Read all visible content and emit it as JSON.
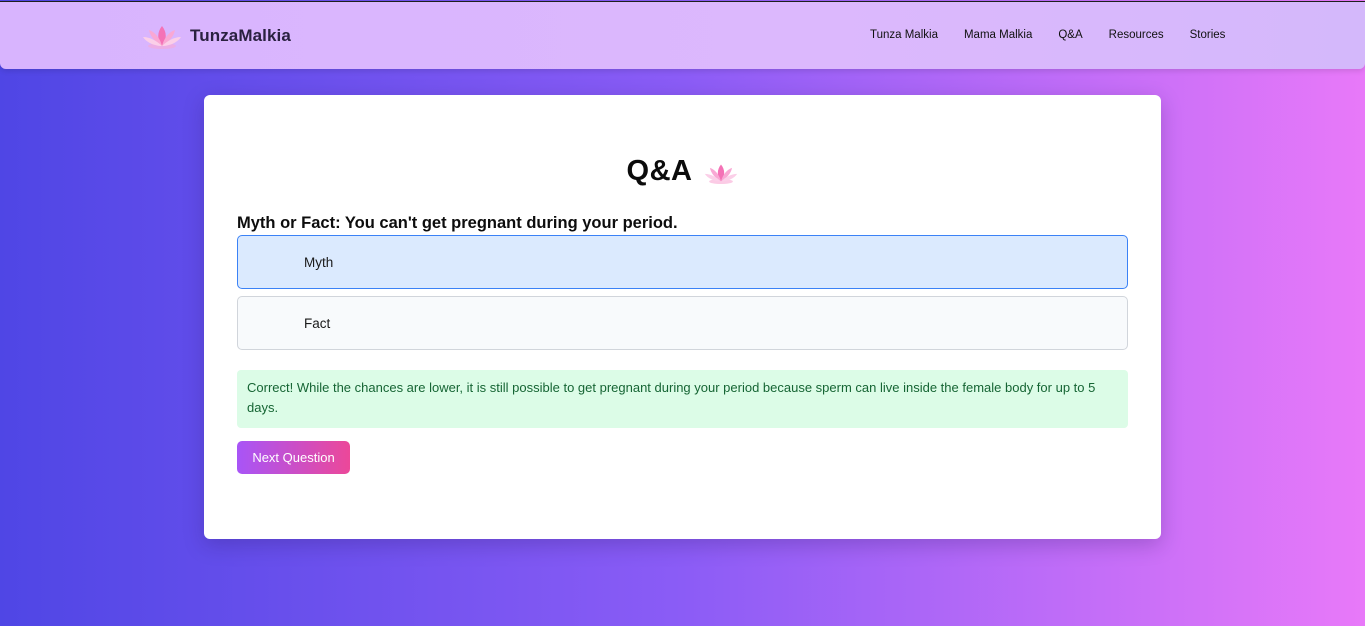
{
  "header": {
    "brand_name": "TunzaMalkia",
    "logo_icon": "lotus-icon",
    "nav": [
      {
        "label": "Tunza Malkia"
      },
      {
        "label": "Mama Malkia"
      },
      {
        "label": "Q&A"
      },
      {
        "label": "Resources"
      },
      {
        "label": "Stories"
      }
    ]
  },
  "main": {
    "title": "Q&A",
    "title_icon": "lotus-icon",
    "question": "Myth or Fact: You can't get pregnant during your period.",
    "options": [
      {
        "label": "Myth",
        "selected": true
      },
      {
        "label": "Fact",
        "selected": false
      }
    ],
    "feedback": "Correct! While the chances are lower, it is still possible to get pregnant during your period because sperm can live inside the female body for up to 5 days.",
    "next_label": "Next Question"
  },
  "colors": {
    "selected_bg": "#dbeafe",
    "selected_border": "#3b82f6",
    "feedback_bg": "#dcfce7",
    "feedback_text": "#166534",
    "button_gradient_start": "#a855f7",
    "button_gradient_end": "#ec4899"
  }
}
